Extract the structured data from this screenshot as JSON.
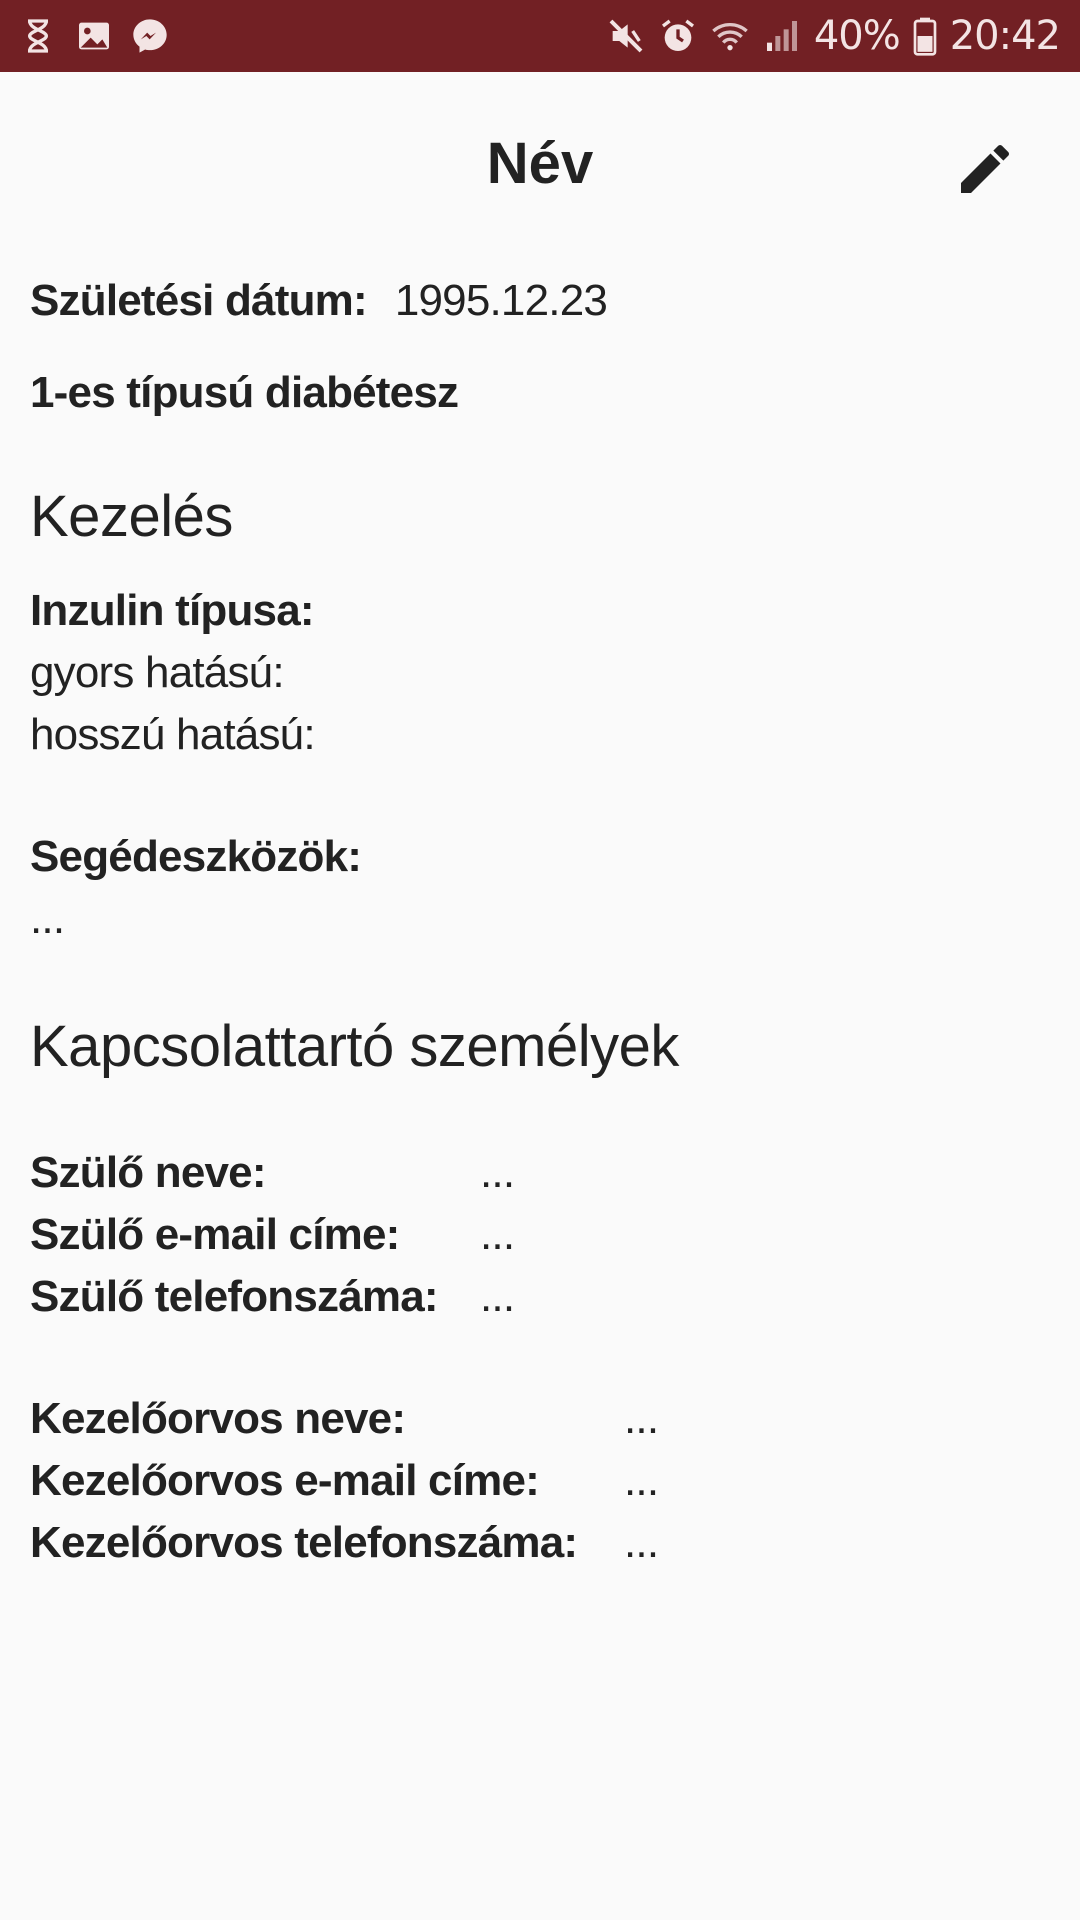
{
  "status_bar": {
    "left_icons": [
      "hourglass-icon",
      "image-icon",
      "messenger-icon"
    ],
    "right_icons": [
      "mute-icon",
      "alarm-icon",
      "wifi-icon",
      "signal-icon",
      "battery-icon"
    ],
    "battery": "40%",
    "time": "20:42",
    "background_color": "#722024"
  },
  "header": {
    "title": "Név",
    "edit_icon": "pencil-icon"
  },
  "profile": {
    "birth_date_label": "Születési dátum:",
    "birth_date_value": "1995.12.23",
    "diabetes_type": "1-es típusú diabétesz"
  },
  "treatment": {
    "title": "Kezelés",
    "insulin_label": "Inzulin típusa:",
    "fast_acting": "gyors hatású:",
    "long_acting": "hosszú hatású:",
    "devices_label": "Segédeszközök:",
    "devices_value": "..."
  },
  "contacts": {
    "title": "Kapcsolattartó személyek",
    "parent": [
      {
        "label": "Szülő neve:",
        "value": "..."
      },
      {
        "label": "Szülő e-mail címe:",
        "value": "..."
      },
      {
        "label": "Szülő telefonszáma:",
        "value": "..."
      }
    ],
    "doctor": [
      {
        "label": "Kezelőorvos neve:",
        "value": "..."
      },
      {
        "label": "Kezelőorvos e-mail címe:",
        "value": "..."
      },
      {
        "label": "Kezelőorvos telefonszáma:",
        "value": "..."
      }
    ]
  }
}
